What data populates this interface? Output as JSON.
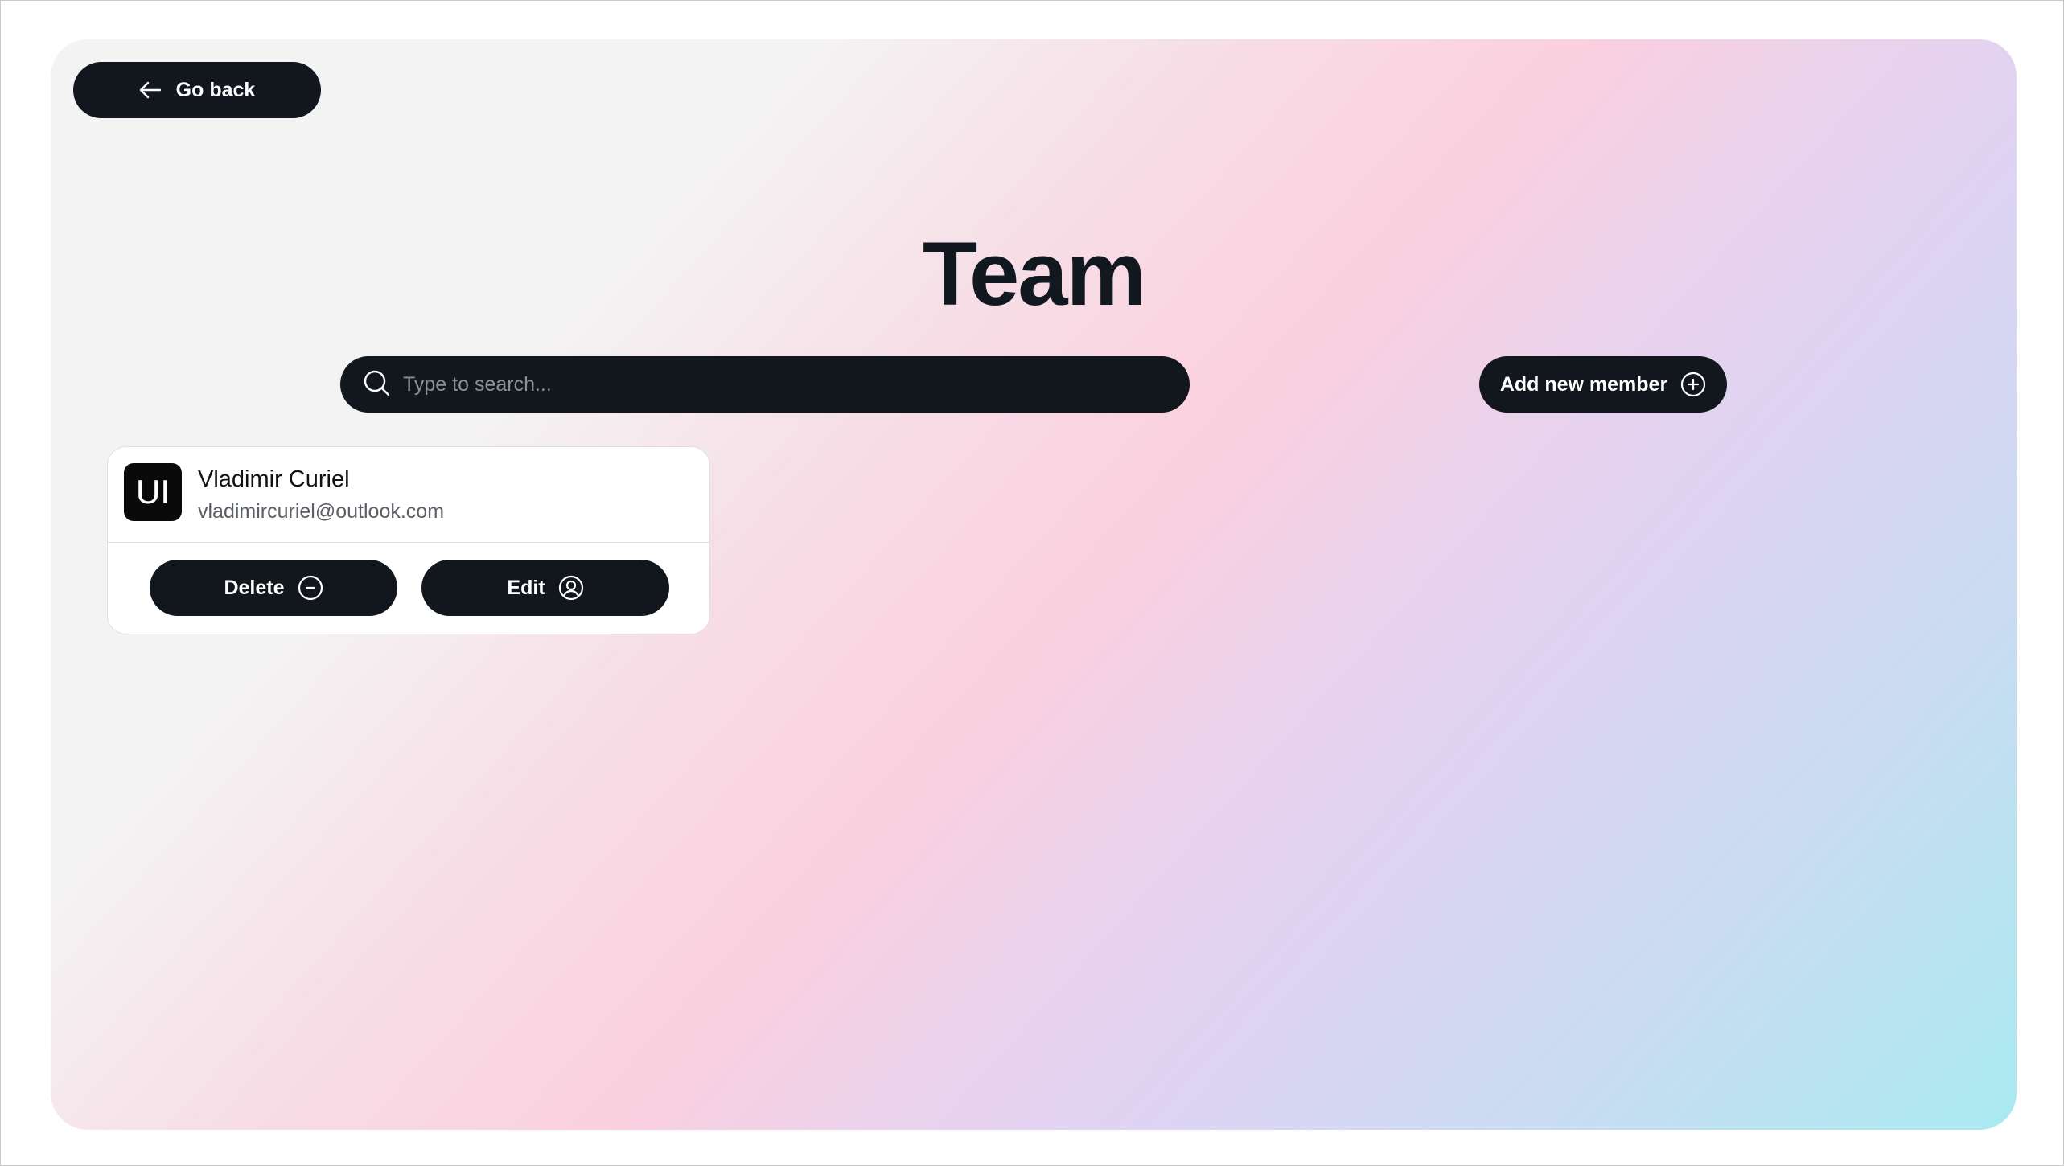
{
  "header": {
    "go_back_label": "Go back",
    "title": "Team"
  },
  "search": {
    "placeholder": "Type to search...",
    "value": ""
  },
  "actions": {
    "add_member_label": "Add new member"
  },
  "members": [
    {
      "initials": "UI",
      "name": "Vladimir Curiel",
      "email": "vladimircuriel@outlook.com",
      "delete_label": "Delete",
      "edit_label": "Edit"
    }
  ],
  "icons": {
    "go_back": "arrow-left-icon",
    "search": "search-icon",
    "add_member": "plus-circle-icon",
    "delete": "minus-circle-icon",
    "edit": "user-circle-icon"
  },
  "colors": {
    "button_bg": "#11171c",
    "button_text": "#ffffff",
    "title": "#121820",
    "avatar_bg": "#0a0a0a"
  }
}
